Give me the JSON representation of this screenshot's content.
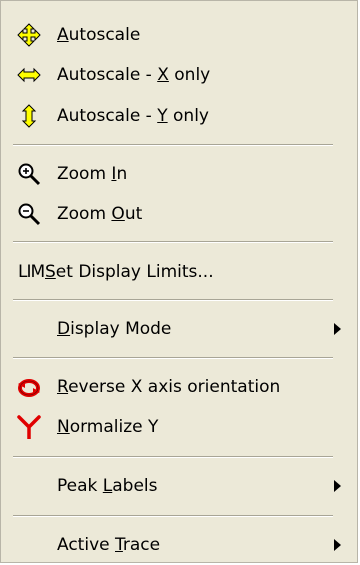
{
  "menu": {
    "items": [
      {
        "pre": "",
        "acc": "A",
        "post": "utoscale",
        "icon": "move-arrows-icon"
      },
      {
        "pre": "Autoscale - ",
        "acc": "X",
        "post": " only",
        "icon": "horizontal-arrow-icon"
      },
      {
        "pre": "Autoscale - ",
        "acc": "Y",
        "post": " only",
        "icon": "vertical-arrow-icon"
      },
      {
        "pre": "Zoom ",
        "acc": "I",
        "post": "n",
        "icon": "zoom-in-icon"
      },
      {
        "pre": "Zoom ",
        "acc": "O",
        "post": "ut",
        "icon": "zoom-out-icon"
      },
      {
        "pre": "",
        "acc": "S",
        "post": "et Display Limits...",
        "icon": "lim-icon",
        "icon_text": "LIM"
      },
      {
        "pre": "",
        "acc": "D",
        "post": "isplay Mode",
        "submenu": true
      },
      {
        "pre": "",
        "acc": "R",
        "post": "everse X axis orientation",
        "icon": "reverse-axis-icon"
      },
      {
        "pre": "",
        "acc": "N",
        "post": "ormalize Y",
        "icon": "normalize-y-icon"
      },
      {
        "pre": "Peak ",
        "acc": "L",
        "post": "abels",
        "submenu": true
      },
      {
        "pre": "Active ",
        "acc": "T",
        "post": "race",
        "submenu": true
      }
    ]
  },
  "colors": {
    "menu_background": "#ece9d8",
    "icon_yellow": "#ffff00",
    "icon_red": "#e00000",
    "separator": "#a8a596"
  }
}
